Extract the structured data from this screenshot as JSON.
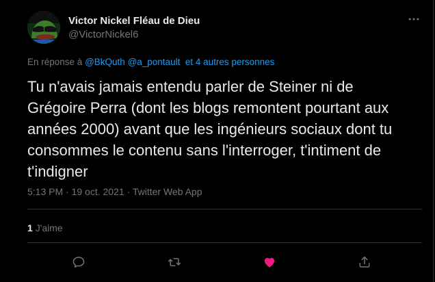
{
  "author": {
    "display_name": "Victor Nickel Fléau de Dieu",
    "handle": "@VictorNickel6"
  },
  "more_icon": "more-horizontal-icon",
  "reply_context": {
    "prefix": "En réponse à ",
    "mentions": [
      "@BkQuth",
      "@a_pontault"
    ],
    "others": "et 4 autres personnes"
  },
  "tweet": {
    "text": "Tu n'avais jamais entendu parler de Steiner ni de Grégoire Perra (dont les blogs remontent pourtant aux années 2000) avant que les ingénieurs sociaux dont tu consommes le contenu sans l'interroger, t'intiment de t'indigner",
    "meta": "5:13 PM · 19 oct. 2021 · Twitter Web App"
  },
  "stats": {
    "likes_count": "1",
    "likes_label": "J'aime"
  },
  "actions": [
    {
      "name": "reply",
      "icon": "reply-icon"
    },
    {
      "name": "retweet",
      "icon": "retweet-icon"
    },
    {
      "name": "like",
      "icon": "heart-icon",
      "active": true
    },
    {
      "name": "share",
      "icon": "share-icon"
    }
  ],
  "colors": {
    "background": "#000000",
    "text": "#e7e9ea",
    "muted": "#71767b",
    "link": "#1d9bf0",
    "like_active": "#f91880",
    "divider": "#2f3336"
  }
}
